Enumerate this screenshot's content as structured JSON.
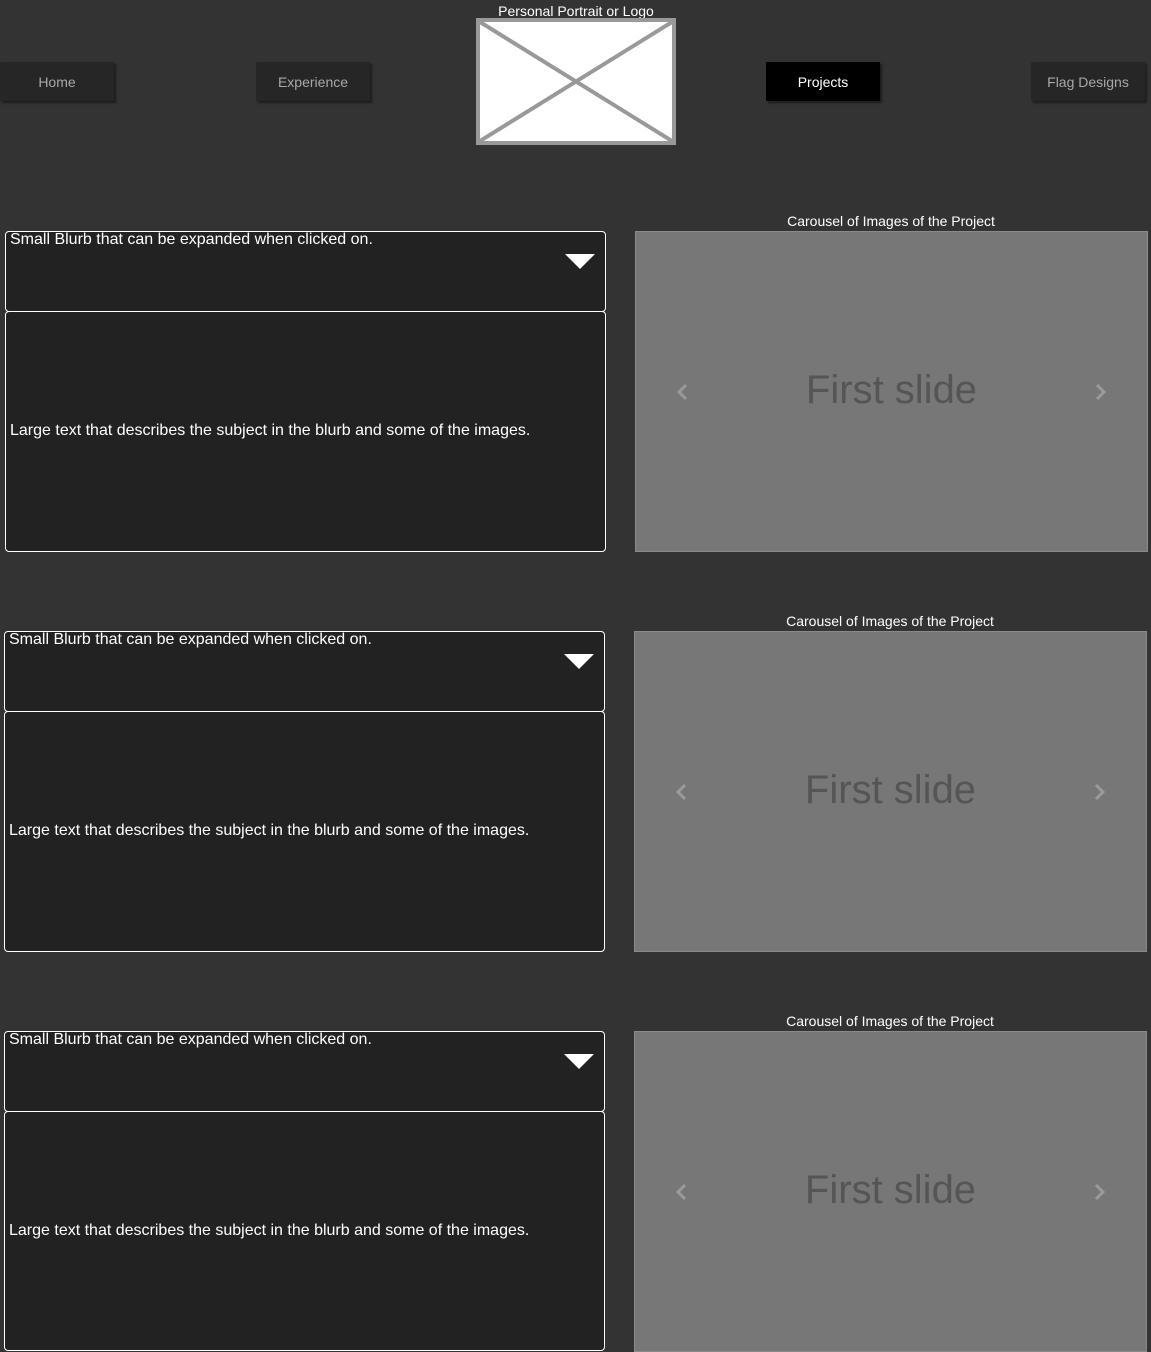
{
  "nav": {
    "items": [
      {
        "label": "Home",
        "active": false
      },
      {
        "label": "Experience",
        "active": false
      },
      {
        "label": "Projects",
        "active": true
      },
      {
        "label": "Flag Designs",
        "active": false
      }
    ]
  },
  "logo": {
    "caption": "Personal Portrait or Logo",
    "icon": "image-placeholder-icon"
  },
  "projects": [
    {
      "blurb": "Small Blurb that can be expanded when clicked on.",
      "description": "Large text that describes the subject in the blurb and some of the images.",
      "carousel_caption": "Carousel of Images of the Project",
      "slide_label": "First slide"
    },
    {
      "blurb": "Small Blurb that can be expanded when clicked on.",
      "description": "Large text that describes the subject in the blurb and some of the images.",
      "carousel_caption": "Carousel of Images of the Project",
      "slide_label": "First slide"
    },
    {
      "blurb": "Small Blurb that can be expanded when clicked on.",
      "description": "Large text that describes the subject in the blurb and some of the images.",
      "carousel_caption": "Carousel of Images of the Project",
      "slide_label": "First slide"
    }
  ],
  "colors": {
    "background": "#333333",
    "panel": "#222222",
    "nav_button": "#262626",
    "nav_button_active": "#000000",
    "carousel": "#777777"
  }
}
